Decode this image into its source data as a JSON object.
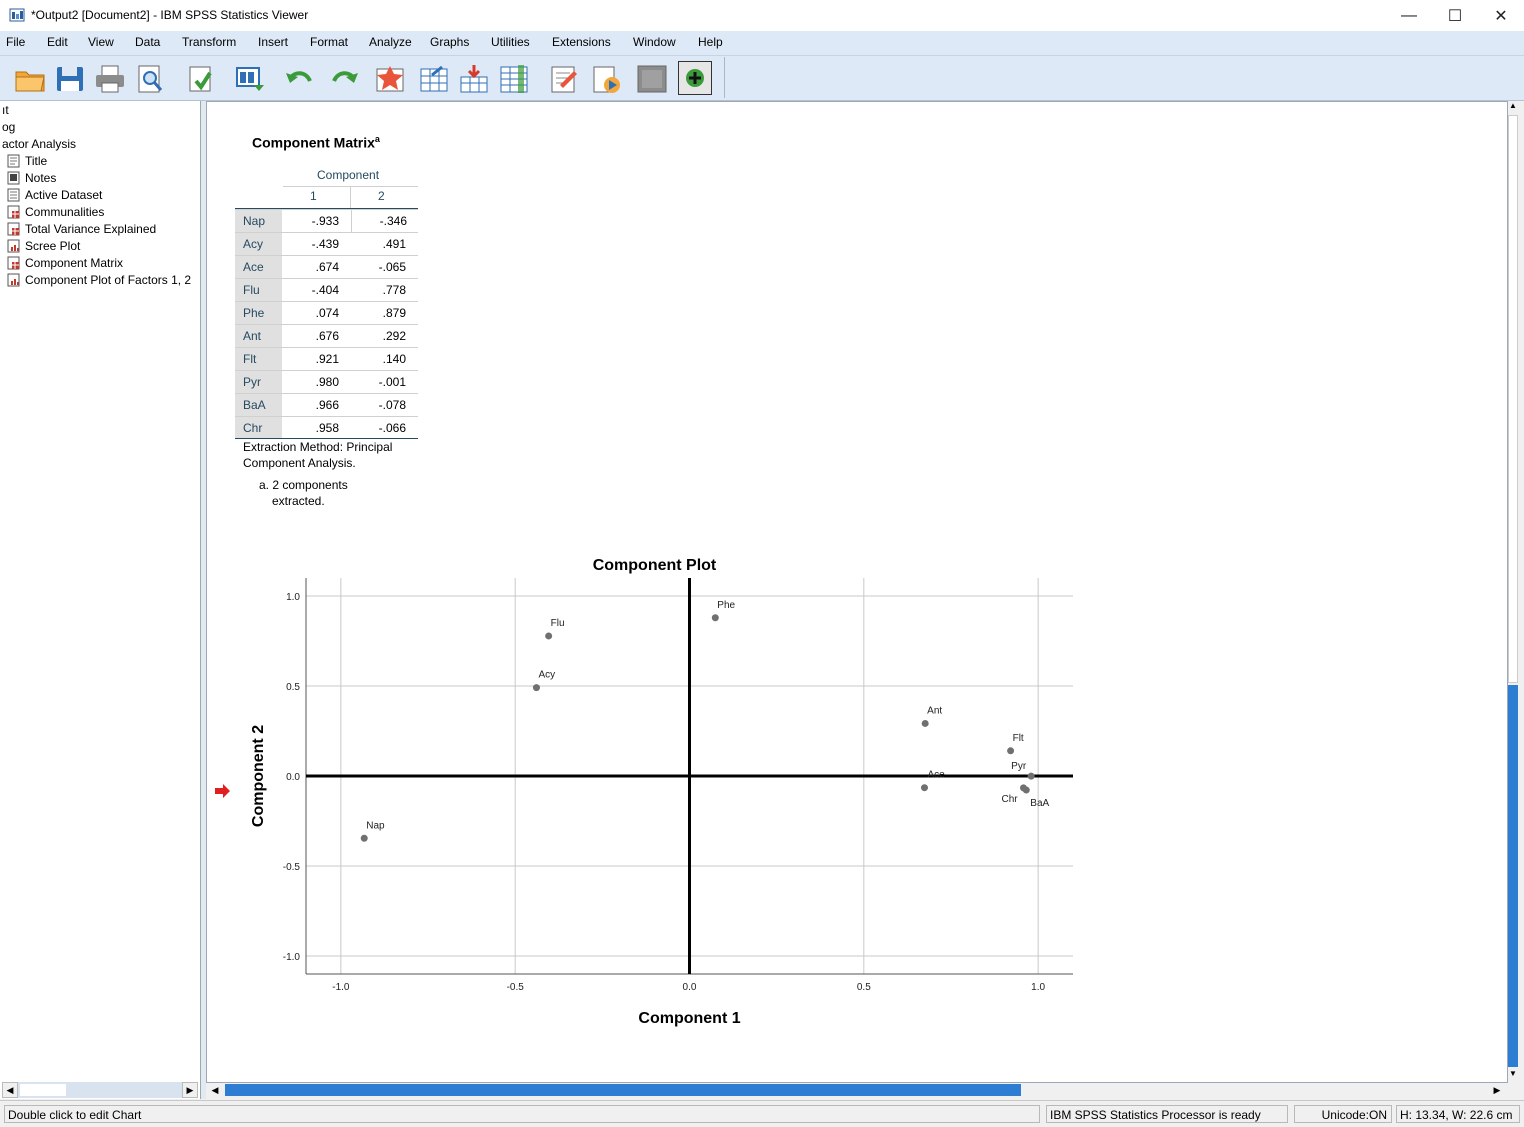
{
  "window": {
    "title": "*Output2 [Document2] - IBM SPSS Statistics Viewer",
    "minimize": "—",
    "maximize": "☐",
    "close": "✕"
  },
  "menu": [
    {
      "label": "File"
    },
    {
      "label": "Edit"
    },
    {
      "label": "View"
    },
    {
      "label": "Data"
    },
    {
      "label": "Transform"
    },
    {
      "label": "Insert"
    },
    {
      "label": "Format"
    },
    {
      "label": "Analyze"
    },
    {
      "label": "Graphs"
    },
    {
      "label": "Utilities"
    },
    {
      "label": "Extensions"
    },
    {
      "label": "Window"
    },
    {
      "label": "Help"
    }
  ],
  "toolbar_icons": [
    "open-icon",
    "save-icon",
    "print-icon",
    "print-preview-icon",
    "export-icon",
    "recall-dialog-icon",
    "undo-icon",
    "redo-icon",
    "goto-data-icon",
    "goto-case-icon",
    "goto-variable-icon",
    "variables-icon",
    "designate-window-icon",
    "run-script-icon",
    "toggle-pane-icon",
    "insert-heading-icon"
  ],
  "outline": {
    "items": [
      {
        "label": "ıt"
      },
      {
        "label": "og"
      },
      {
        "label": "actor Analysis"
      },
      {
        "label": "Title"
      },
      {
        "label": "Notes"
      },
      {
        "label": "Active Dataset"
      },
      {
        "label": "Communalities"
      },
      {
        "label": "Total Variance Explained"
      },
      {
        "label": "Scree Plot"
      },
      {
        "label": "Component Matrix"
      },
      {
        "label": "Component Plot of Factors 1, 2"
      }
    ]
  },
  "table": {
    "title": "Component Matrix",
    "title_sup": "a",
    "header_group": "Component",
    "col1": "1",
    "col2": "2",
    "rows": [
      {
        "label": "Nap",
        "c1": "-.933",
        "c2": "-.346"
      },
      {
        "label": "Acy",
        "c1": "-.439",
        "c2": ".491"
      },
      {
        "label": "Ace",
        "c1": ".674",
        "c2": "-.065"
      },
      {
        "label": "Flu",
        "c1": "-.404",
        "c2": ".778"
      },
      {
        "label": "Phe",
        "c1": ".074",
        "c2": ".879"
      },
      {
        "label": "Ant",
        "c1": ".676",
        "c2": ".292"
      },
      {
        "label": "Flt",
        "c1": ".921",
        "c2": ".140"
      },
      {
        "label": "Pyr",
        "c1": ".980",
        "c2": "-.001"
      },
      {
        "label": "BaA",
        "c1": ".966",
        "c2": "-.078"
      },
      {
        "label": "Chr",
        "c1": ".958",
        "c2": "-.066"
      }
    ],
    "footnote1_line1": "Extraction Method: Principal",
    "footnote1_line2": "Component Analysis.",
    "footnote2_line1": "a. 2 components",
    "footnote2_line2": "extracted."
  },
  "chart_data": {
    "type": "scatter",
    "title": "Component Plot",
    "xlabel": "Component 1",
    "ylabel": "Component 2",
    "xlim": [
      -1.1,
      1.1
    ],
    "ylim": [
      -1.1,
      1.1
    ],
    "xticks": [
      "-1.0",
      "-0.5",
      "0.0",
      "0.5",
      "1.0"
    ],
    "xtick_values": [
      -1.0,
      -0.5,
      0.0,
      0.5,
      1.0
    ],
    "yticks": [
      "1.0",
      "0.5",
      "0.0",
      "-0.5",
      "-1.0"
    ],
    "ytick_values": [
      1.0,
      0.5,
      0.0,
      -0.5,
      -1.0
    ],
    "grid": true,
    "points": [
      {
        "label": "Nap",
        "x": -0.933,
        "y": -0.346
      },
      {
        "label": "Acy",
        "x": -0.439,
        "y": 0.491
      },
      {
        "label": "Ace",
        "x": 0.674,
        "y": -0.065
      },
      {
        "label": "Flu",
        "x": -0.404,
        "y": 0.778
      },
      {
        "label": "Phe",
        "x": 0.074,
        "y": 0.879
      },
      {
        "label": "Ant",
        "x": 0.676,
        "y": 0.292
      },
      {
        "label": "Flt",
        "x": 0.921,
        "y": 0.14
      },
      {
        "label": "Pyr",
        "x": 0.98,
        "y": -0.001
      },
      {
        "label": "BaA",
        "x": 0.966,
        "y": -0.078
      },
      {
        "label": "Chr",
        "x": 0.958,
        "y": -0.066
      }
    ]
  },
  "status": {
    "hint": "Double click to edit Chart",
    "processor": "IBM SPSS Statistics Processor is ready",
    "unicode": "Unicode:ON",
    "size": "H: 13.34, W: 22.6 cm"
  }
}
